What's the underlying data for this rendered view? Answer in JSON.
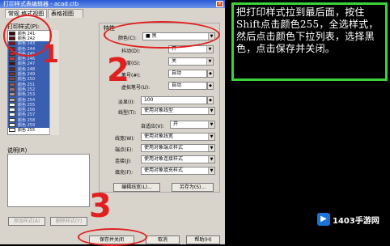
{
  "window": {
    "title": "打印样式表编辑器 - acad.ctb",
    "close": "×"
  },
  "tabs": [
    {
      "label": "常规 格式视图"
    },
    {
      "label": "表格视图"
    }
  ],
  "styles_label": "打印样式(P):",
  "styles": [
    {
      "name": "颜色 241",
      "color": "#3a0a0a"
    },
    {
      "name": "颜色 242",
      "color": "#5a1010"
    },
    {
      "name": "颜色 243",
      "color": "#7a1818"
    },
    {
      "name": "颜色 244",
      "color": "#a01c1c"
    },
    {
      "name": "颜色 245",
      "color": "#b02828"
    },
    {
      "name": "颜色 246",
      "color": "#c83a3a"
    },
    {
      "name": "颜色 247",
      "color": "#401818"
    },
    {
      "name": "颜色 248",
      "color": "#602828"
    },
    {
      "name": "颜色 249",
      "color": "#703838"
    },
    {
      "name": "颜色 250",
      "color": "#804848"
    },
    {
      "name": "颜色 251",
      "color": "#905858"
    },
    {
      "name": "颜色 252",
      "color": "#a07070"
    },
    {
      "name": "颜色 253",
      "color": "#b09090"
    },
    {
      "name": "颜色 254",
      "color": "#c0b0b0"
    },
    {
      "name": "颜色 255",
      "color": "#ffffff"
    },
    {
      "name": "颜色 256",
      "color": "#ffffff"
    },
    {
      "name": "颜色 257",
      "color": "#ffffff"
    },
    {
      "name": "颜色 258",
      "color": "#ffffff"
    },
    {
      "name": "颜色 259",
      "color": "#ffffff"
    },
    {
      "name": "颜色 255",
      "color": "#ffffff"
    }
  ],
  "desc_label": "说明(R)",
  "group_label": "特性",
  "props": {
    "color": {
      "label": "颜色(C):",
      "value": "■ 黑"
    },
    "dither": {
      "label": "抖动(D):",
      "value": "开"
    },
    "gray": {
      "label": "灰度(G):",
      "value": "关"
    },
    "pen": {
      "label": "笔号(#):",
      "value": "自动"
    },
    "vpen": {
      "label": "虚拟笔号(U):",
      "value": "自动"
    },
    "screen": {
      "label": "淡显(I):",
      "value": "100"
    },
    "ltype": {
      "label": "线型(T):",
      "value": "使用对象线型"
    },
    "adaptive": {
      "label": "自适应(V):",
      "value": "开"
    },
    "lweight": {
      "label": "线宽(W):",
      "value": "使用对象线宽"
    },
    "endstyle": {
      "label": "端点(E):",
      "value": "使用对象端点样式"
    },
    "joinstyle": {
      "label": "连接(J):",
      "value": "使用对象连接样式"
    },
    "fillstyle": {
      "label": "填充(F):",
      "value": "使用对象填充样式"
    }
  },
  "buttons": {
    "edit_lw": "编辑线宽(L)...",
    "save_as": "另存为(S)...",
    "add_style": "添加样式(A)",
    "del_style": "删除样式(Y)",
    "save_close": "保存并关闭",
    "cancel": "取消",
    "help": "帮助(H)"
  },
  "annotations": {
    "one": "1",
    "two": "2",
    "three": "3"
  },
  "instruction": "把打印样式拉到最后面，按住Shift点击颜色255，全选样式，然后点击颜色下拉列表，选择黑色，点击保存并关闭。",
  "watermark": {
    "mark": "▶",
    "text": "1403手游网"
  }
}
